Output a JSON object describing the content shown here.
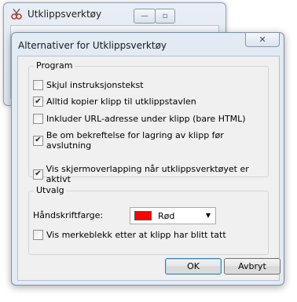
{
  "background_window": {
    "title": "Utklippsverktøy",
    "minimize_glyph": "—",
    "maximize_glyph": "▫"
  },
  "dialog": {
    "title": "Alternativer for Utklippsverktøy",
    "close_glyph": "✕",
    "program_group": {
      "label": "Program",
      "options": [
        {
          "label": "Skjul instruksjonstekst",
          "checked": false
        },
        {
          "label": "Alltid kopier klipp til utklippstavlen",
          "checked": true
        },
        {
          "label": "Inkluder URL-adresse under klipp (bare HTML)",
          "checked": false
        },
        {
          "label": "Be om bekreftelse for lagring av klipp før avslutning",
          "checked": true
        },
        {
          "label": "Vis skjermoverlapping når utklippsverktøyet er aktivt",
          "checked": true
        }
      ]
    },
    "selection_group": {
      "label": "Utvalg",
      "ink_color_label": "Håndskriftfarge:",
      "ink_color_value": "Rød",
      "ink_color_hex": "#ff0000",
      "show_ink_option": {
        "label": "Vis merkeblekk etter at klipp har blitt tatt",
        "checked": false
      }
    },
    "ok_label": "OK",
    "cancel_label": "Avbryt"
  },
  "icons": {
    "app_icon": "scissors-icon",
    "dropdown": "chevron-down-icon",
    "check": "✔"
  }
}
